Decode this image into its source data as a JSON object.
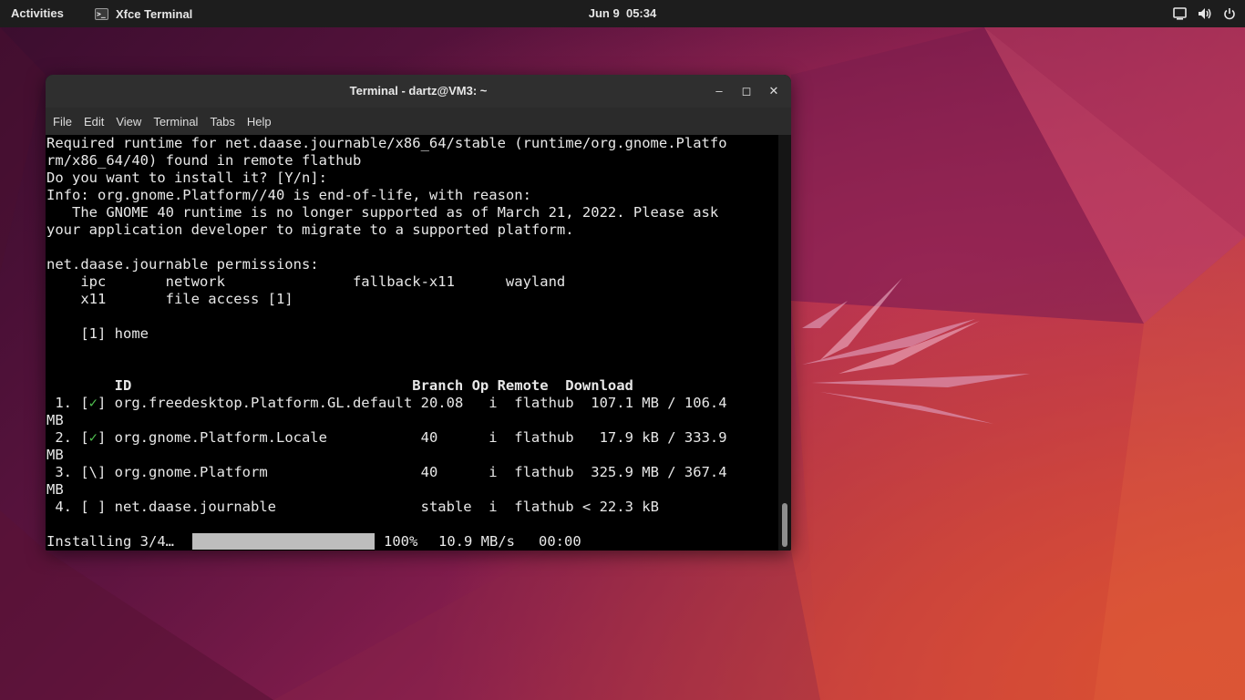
{
  "topbar": {
    "activities": "Activities",
    "app_name": "Xfce Terminal",
    "app_icon": "terminal-icon",
    "date": "Jun 9",
    "time": "05:34",
    "tray_icons": [
      "display-icon",
      "volume-icon",
      "power-icon"
    ]
  },
  "window": {
    "title": "Terminal - dartz@VM3: ~",
    "min_label": "–",
    "max_label": "◻",
    "close_label": "✕",
    "menu": [
      "File",
      "Edit",
      "View",
      "Terminal",
      "Tabs",
      "Help"
    ]
  },
  "terminal": {
    "lines": [
      "Required runtime for net.daase.journable/x86_64/stable (runtime/org.gnome.Platfo",
      "rm/x86_64/40) found in remote flathub",
      "Do you want to install it? [Y/n]:",
      "Info: org.gnome.Platform//40 is end-of-life, with reason:",
      "   The GNOME 40 runtime is no longer supported as of March 21, 2022. Please ask",
      "your application developer to migrate to a supported platform.",
      "",
      "net.daase.journable permissions:",
      "    ipc       network               fallback-x11      wayland",
      "    x11       file access [1]",
      "",
      "    [1] home",
      "",
      ""
    ],
    "table_header": "        ID                                 Branch Op Remote  Download",
    "rows": [
      {
        "num": " 1. [",
        "mark": "✓",
        "rest": "] org.freedesktop.Platform.GL.default 20.08   i  flathub  107.1 MB / 106.4",
        "wrap": "MB"
      },
      {
        "num": " 2. [",
        "mark": "✓",
        "rest": "] org.gnome.Platform.Locale           40      i  flathub   17.9 kB / 333.9",
        "wrap": "MB"
      },
      {
        "num": " 3. [",
        "mark": "\\",
        "rest": "] org.gnome.Platform                  40      i  flathub  325.9 MB / 367.4",
        "wrap": "MB"
      },
      {
        "num": " 4. [",
        "mark": " ",
        "rest": "] net.daase.journable                 stable  i  flathub < 22.3 kB",
        "wrap": ""
      }
    ],
    "status": {
      "label": "Installing 3/4…",
      "progress": 1.0,
      "percent": "100%",
      "speed": "10.9 MB/s",
      "eta": "00:00"
    }
  }
}
